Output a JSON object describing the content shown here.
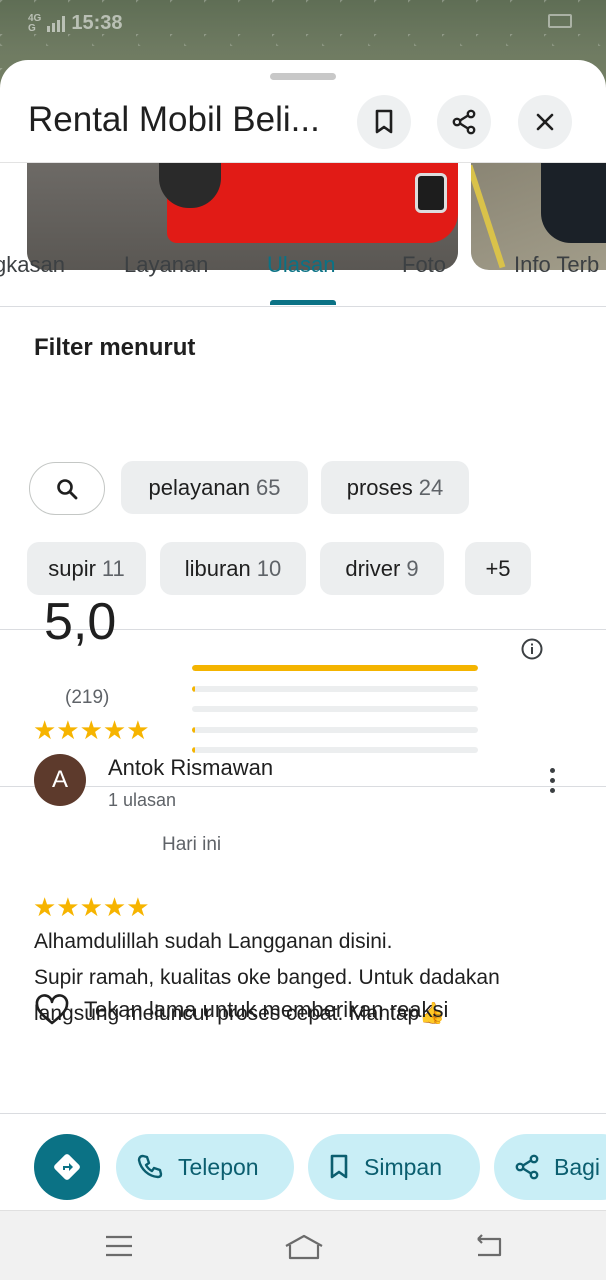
{
  "status_bar": {
    "network": "4G",
    "signal": "G",
    "time": "15:38"
  },
  "place": {
    "title": "Rental Mobil Beli..."
  },
  "header_buttons": {
    "save": "bookmark-icon",
    "share": "share-icon",
    "close": "close-icon"
  },
  "tabs": [
    {
      "label": "gkasan",
      "active": false
    },
    {
      "label": "Layanan",
      "active": false
    },
    {
      "label": "Ulasan",
      "active": true
    },
    {
      "label": "Foto",
      "active": false
    },
    {
      "label": "Info Terb",
      "active": false
    }
  ],
  "filter": {
    "title": "Filter menurut",
    "chips": [
      {
        "label": "pelayanan",
        "count": "65"
      },
      {
        "label": "proses",
        "count": "24"
      },
      {
        "label": "supir",
        "count": "11"
      },
      {
        "label": "liburan",
        "count": "10"
      },
      {
        "label": "driver",
        "count": "9"
      },
      {
        "label": "+5",
        "count": ""
      }
    ]
  },
  "rating": {
    "value": "5,0",
    "stars": "★★★★★",
    "count": "(219)",
    "distribution": [
      {
        "stars": 5,
        "fraction": 1.0
      },
      {
        "stars": 4,
        "fraction": 0.01
      },
      {
        "stars": 3,
        "fraction": 0.0
      },
      {
        "stars": 2,
        "fraction": 0.01
      },
      {
        "stars": 1,
        "fraction": 0.01
      }
    ]
  },
  "review": {
    "avatar_letter": "A",
    "avatar_color": "#5d3a2c",
    "name": "Antok Rismawan",
    "meta": "1 ulasan",
    "stars": "★★★★★",
    "date": "Hari ini",
    "lines": [
      "Alhamdulillah sudah Langganan disini.",
      "Supir ramah, kualitas oke banged. Untuk dadakan",
      "langsung meluncur proses cepat. Mantap👍"
    ],
    "reaction_label": "Tekan lama untuk memberikan reaksi"
  },
  "actions": {
    "directions_icon": "directions-icon",
    "call": "Telepon",
    "save": "Simpan",
    "share": "Bagi"
  },
  "colors": {
    "accent": "#0b7285",
    "star": "#f6b400",
    "pill_bg": "#c9eef6"
  }
}
